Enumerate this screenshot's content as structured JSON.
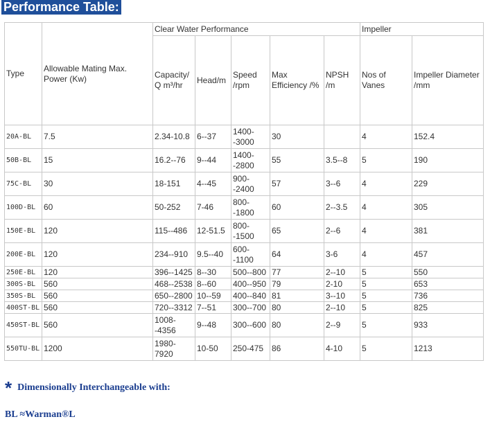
{
  "title": "Performance Table:",
  "headers": {
    "type": "Type",
    "power": "Allowable Mating Max. Power (Kw)",
    "clear_water": "Clear Water Performance",
    "impeller": "Impeller",
    "capacity": "Capacity/ Q m³/hr",
    "head": "Head/m",
    "speed": "Speed /rpm",
    "efficiency": "Max Efficiency /%",
    "npsh": "NPSH /m",
    "vanes": "Nos of Vanes",
    "diameter": "Impeller Diameter /mm"
  },
  "rows": [
    {
      "type": "20A-BL",
      "power": "7.5",
      "capacity": "2.34-10.8",
      "head": "6--37",
      "speed": "1400--3000",
      "eff": "30",
      "npsh": "",
      "vanes": "4",
      "dia": "152.4"
    },
    {
      "type": "50B-BL",
      "power": "15",
      "capacity": "16.2--76",
      "head": "9--44",
      "speed": "1400--2800",
      "eff": "55",
      "npsh": "3.5--8",
      "vanes": "5",
      "dia": "190"
    },
    {
      "type": "75C-BL",
      "power": "30",
      "capacity": "18-151",
      "head": "4--45",
      "speed": "900--2400",
      "eff": "57",
      "npsh": "3--6",
      "vanes": "4",
      "dia": "229"
    },
    {
      "type": "100D-BL",
      "power": "60",
      "capacity": "50-252",
      "head": "7-46",
      "speed": "800--1800",
      "eff": "60",
      "npsh": "2--3.5",
      "vanes": "4",
      "dia": "305"
    },
    {
      "type": "150E-BL",
      "power": "120",
      "capacity": "115--486",
      "head": "12-51.5",
      "speed": "800--1500",
      "eff": "65",
      "npsh": "2--6",
      "vanes": "4",
      "dia": "381"
    },
    {
      "type": "200E-BL",
      "power": "120",
      "capacity": "234--910",
      "head": "9.5--40",
      "speed": "600--1100",
      "eff": "64",
      "npsh": "3-6",
      "vanes": "4",
      "dia": "457"
    },
    {
      "type": "250E-BL",
      "power": "120",
      "capacity": "396--1425",
      "head": "8--30",
      "speed": "500--800",
      "eff": "77",
      "npsh": "2--10",
      "vanes": "5",
      "dia": "550"
    },
    {
      "type": "300S-BL",
      "power": "560",
      "capacity": "468--2538",
      "head": "8--60",
      "speed": "400--950",
      "eff": "79",
      "npsh": "2-10",
      "vanes": "5",
      "dia": "653"
    },
    {
      "type": "350S-BL",
      "power": "560",
      "capacity": "650--2800",
      "head": "10--59",
      "speed": "400--840",
      "eff": "81",
      "npsh": "3--10",
      "vanes": "5",
      "dia": "736"
    },
    {
      "type": "400ST-BL",
      "power": "560",
      "capacity": "720--3312",
      "head": "7--51",
      "speed": "300--700",
      "eff": "80",
      "npsh": "2--10",
      "vanes": "5",
      "dia": "825"
    },
    {
      "type": "450ST-BL",
      "power": "560",
      "capacity": "1008--4356",
      "head": "9--48",
      "speed": "300--600",
      "eff": "80",
      "npsh": "2--9",
      "vanes": "5",
      "dia": " 933"
    },
    {
      "type": "550TU-BL",
      "power": "1200",
      "capacity": "1980-7920",
      "head": "10-50",
      "speed": "250-475",
      "eff": "86",
      "npsh": "4-10",
      "vanes": "5",
      "dia": "1213"
    }
  ],
  "note": {
    "star": "*",
    "text": "Dimensionally Interchangeable with:",
    "bl": "BL ≈Warman®L"
  }
}
